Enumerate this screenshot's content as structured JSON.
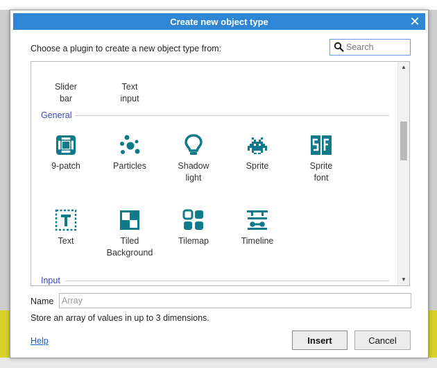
{
  "dialog": {
    "title": "Create new object type",
    "prompt": "Choose a plugin to create a new object type from:",
    "search_placeholder": "Search"
  },
  "list": {
    "top_items": [
      {
        "label": "Slider\nbar",
        "icon": "slider-bar-icon"
      },
      {
        "label": "Text\ninput",
        "icon": "text-input-icon"
      }
    ],
    "sections": [
      {
        "title": "General",
        "items": [
          {
            "label": "9-patch",
            "icon": "nine-patch-icon"
          },
          {
            "label": "Particles",
            "icon": "particles-icon"
          },
          {
            "label": "Shadow\nlight",
            "icon": "shadow-light-icon"
          },
          {
            "label": "Sprite",
            "icon": "sprite-icon"
          },
          {
            "label": "Sprite\nfont",
            "icon": "sprite-font-icon"
          },
          {
            "label": "Text",
            "icon": "text-icon"
          },
          {
            "label": "Tiled\nBackground",
            "icon": "tiled-background-icon"
          },
          {
            "label": "Tilemap",
            "icon": "tilemap-icon"
          },
          {
            "label": "Timeline",
            "icon": "timeline-icon"
          }
        ]
      },
      {
        "title": "Input",
        "items": []
      }
    ]
  },
  "name_field": {
    "label": "Name",
    "placeholder": "Array"
  },
  "description": "Store an array of values in up to 3 dimensions.",
  "footer": {
    "help_label": "Help",
    "insert_label": "Insert",
    "cancel_label": "Cancel"
  },
  "colors": {
    "titlebar": "#2e86d4",
    "icon": "#0e7a8a",
    "section_title": "#3b48c2"
  }
}
